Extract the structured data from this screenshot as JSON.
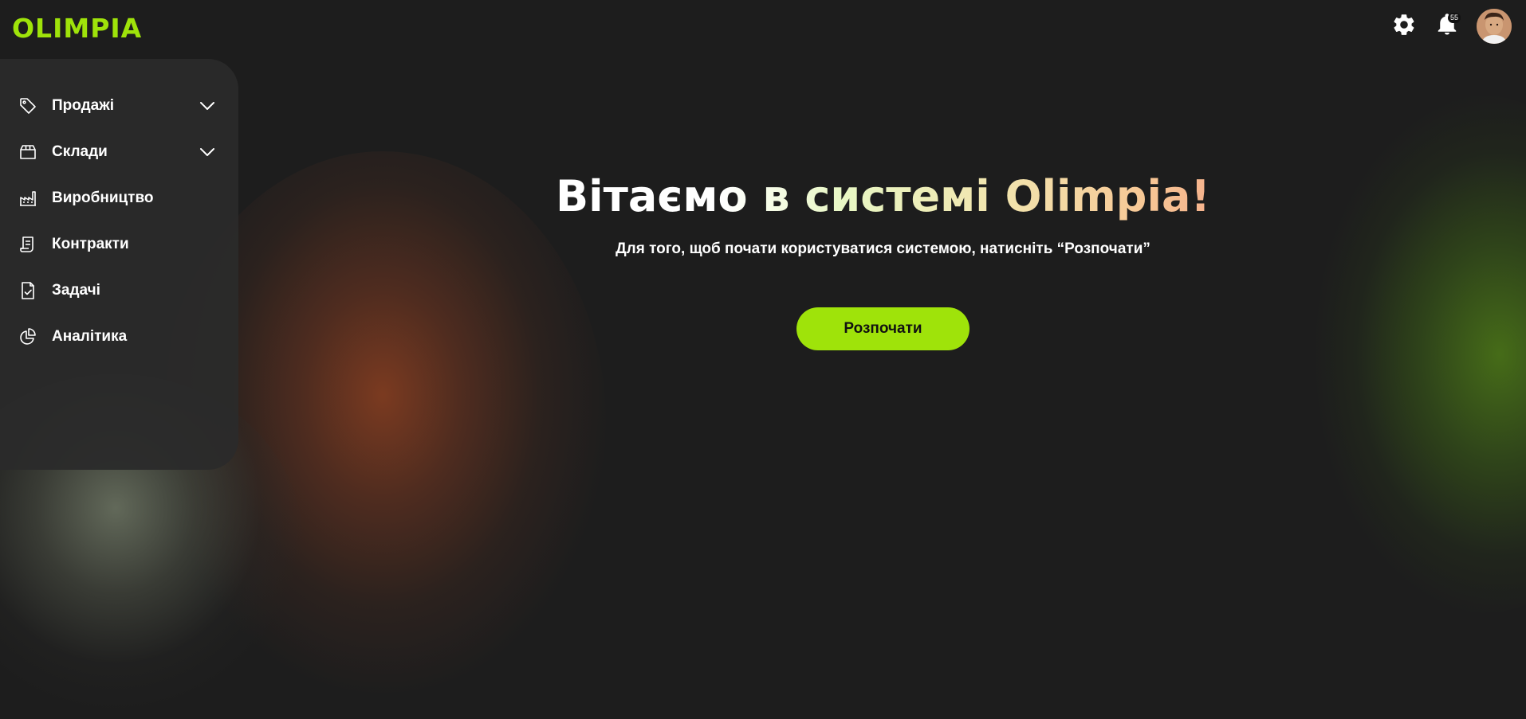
{
  "header": {
    "logo": "OLIMPIA",
    "notifications_count": "55"
  },
  "sidebar": {
    "items": [
      {
        "label": "Продажі",
        "icon": "tag-icon",
        "has_submenu": true
      },
      {
        "label": "Склади",
        "icon": "box-icon",
        "has_submenu": true
      },
      {
        "label": "Виробництво",
        "icon": "factory-icon",
        "has_submenu": false
      },
      {
        "label": "Контракти",
        "icon": "document-icon",
        "has_submenu": false
      },
      {
        "label": "Задачі",
        "icon": "task-check-icon",
        "has_submenu": false
      },
      {
        "label": "Аналітика",
        "icon": "pie-chart-icon",
        "has_submenu": false
      }
    ]
  },
  "hero": {
    "title": "Вітаємо в системі Olimpia!",
    "subtitle": "Для того, щоб почати користуватися системою, натисніть “Розпочати”",
    "button_label": "Розпочати"
  },
  "colors": {
    "accent": "#9fe30a",
    "background": "#1e1e1e",
    "sidebar": "#2a2a2a"
  }
}
